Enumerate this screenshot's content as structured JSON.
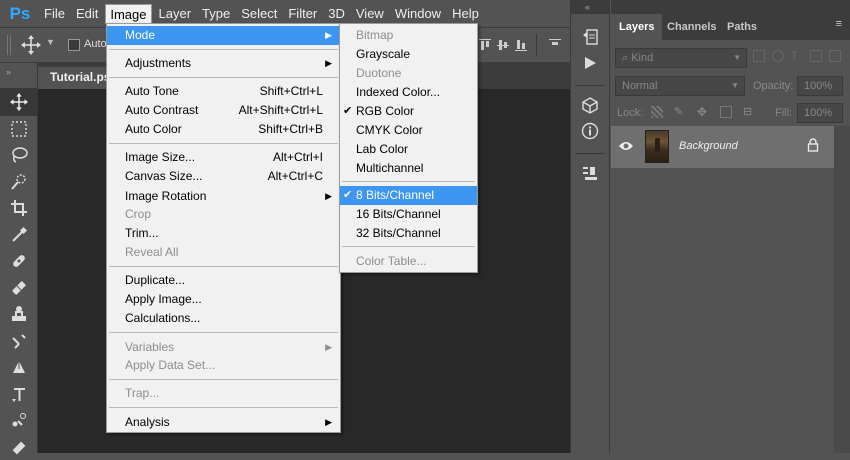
{
  "app": {
    "logo": "Ps"
  },
  "menubar": {
    "items": [
      "File",
      "Edit",
      "Image",
      "Layer",
      "Type",
      "Select",
      "Filter",
      "3D",
      "View",
      "Window",
      "Help"
    ],
    "active": "Image"
  },
  "options_bar": {
    "auto_label": "Auto"
  },
  "document": {
    "tab_title": "Tutorial.psd"
  },
  "image_menu": {
    "mode": "Mode",
    "adjustments": "Adjustments",
    "auto_tone": {
      "label": "Auto Tone",
      "shortcut": "Shift+Ctrl+L"
    },
    "auto_contrast": {
      "label": "Auto Contrast",
      "shortcut": "Alt+Shift+Ctrl+L"
    },
    "auto_color": {
      "label": "Auto Color",
      "shortcut": "Shift+Ctrl+B"
    },
    "image_size": {
      "label": "Image Size...",
      "shortcut": "Alt+Ctrl+I"
    },
    "canvas_size": {
      "label": "Canvas Size...",
      "shortcut": "Alt+Ctrl+C"
    },
    "image_rotation": "Image Rotation",
    "crop": "Crop",
    "trim": "Trim...",
    "reveal_all": "Reveal All",
    "duplicate": "Duplicate...",
    "apply_image": "Apply Image...",
    "calculations": "Calculations...",
    "variables": "Variables",
    "apply_data_set": "Apply Data Set...",
    "trap": "Trap...",
    "analysis": "Analysis"
  },
  "mode_menu": {
    "bitmap": "Bitmap",
    "grayscale": "Grayscale",
    "duotone": "Duotone",
    "indexed_color": "Indexed Color...",
    "rgb_color": "RGB Color",
    "cmyk_color": "CMYK Color",
    "lab_color": "Lab Color",
    "multichannel": "Multichannel",
    "bits8": "8 Bits/Channel",
    "bits16": "16 Bits/Channel",
    "bits32": "32 Bits/Channel",
    "color_table": "Color Table..."
  },
  "layers_panel": {
    "tabs": [
      "Layers",
      "Channels",
      "Paths"
    ],
    "kind_label": "Kind",
    "blend_mode": "Normal",
    "opacity_label": "Opacity:",
    "opacity_value": "100%",
    "lock_label": "Lock:",
    "fill_label": "Fill:",
    "fill_value": "100%",
    "layer_name": "Background"
  },
  "colors": {
    "accent": "#3c96f2",
    "ps_blue": "#31a8ff"
  }
}
